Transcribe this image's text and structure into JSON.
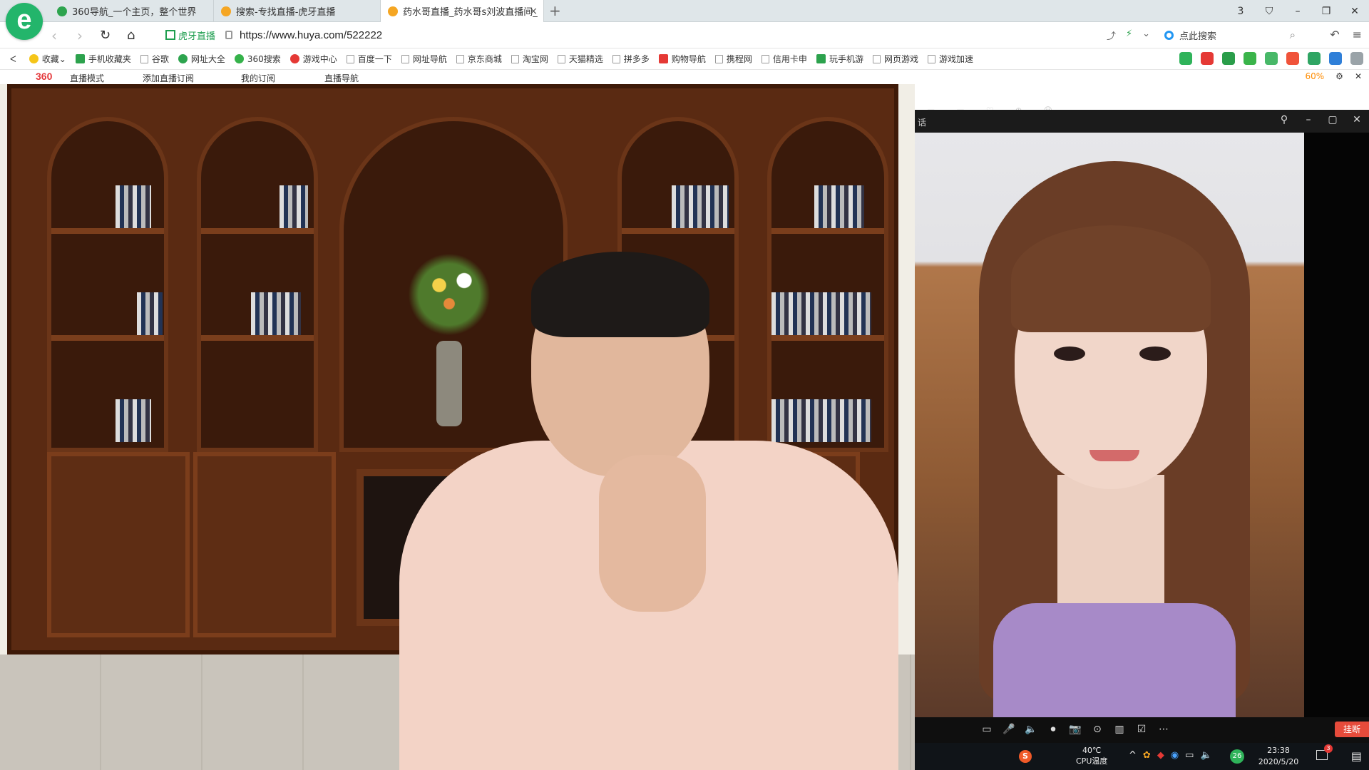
{
  "browser": {
    "logo_letter": "e",
    "tabs": [
      {
        "title": "360导航_一个主页，整个世界",
        "favicon_color": "#2da44e"
      },
      {
        "title": "搜索-专找直播-虎牙直播",
        "favicon_color": "#f5a623"
      },
      {
        "title": "药水哥直播_药水哥s刘波直播间_",
        "favicon_color": "#f5a623",
        "active": true
      }
    ],
    "tab_close": "×",
    "new_tab": "+",
    "window_buttons": [
      "3",
      "⛉",
      "–",
      "❐",
      "✕"
    ],
    "site_badge": "虎牙直播",
    "url": "https://www.huya.com/522222",
    "search_placeholder": "点此搜索"
  },
  "bookmarks": [
    "收藏",
    "手机收藏夹",
    "谷歌",
    "网址大全",
    "360搜索",
    "游戏中心",
    "百度一下",
    "网址导航",
    "京东商城",
    "淘宝网",
    "天猫精选",
    "拼多多",
    "购物导航",
    "携程网",
    "信用卡申",
    "玩手机游",
    "网页游戏",
    "游戏加速"
  ],
  "pagebar": {
    "brand": "360",
    "mode": "直播模式",
    "add_sub": "添加直播订阅",
    "my_sub": "我的订阅",
    "nav": "直播导航",
    "battery": "60%"
  },
  "call": {
    "title_char": "话",
    "window_buttons": [
      "⚲",
      "–",
      "▢",
      "✕"
    ],
    "controls": [
      "▭",
      "🎤",
      "🔈",
      "⏺",
      "📷",
      "⊙",
      "▥",
      "☑",
      "⋯"
    ],
    "hangup": "挂断"
  },
  "taskbar": {
    "temperature": "40℃",
    "cpu_label": "CPU温度",
    "badge": "26",
    "time": "23:38",
    "date": "2020/5/20",
    "notif_count": "3"
  },
  "colors": {
    "tab_strip": "#dfe6e9",
    "accent_green": "#1e9e4f",
    "hangup_red": "#e64b3b"
  }
}
